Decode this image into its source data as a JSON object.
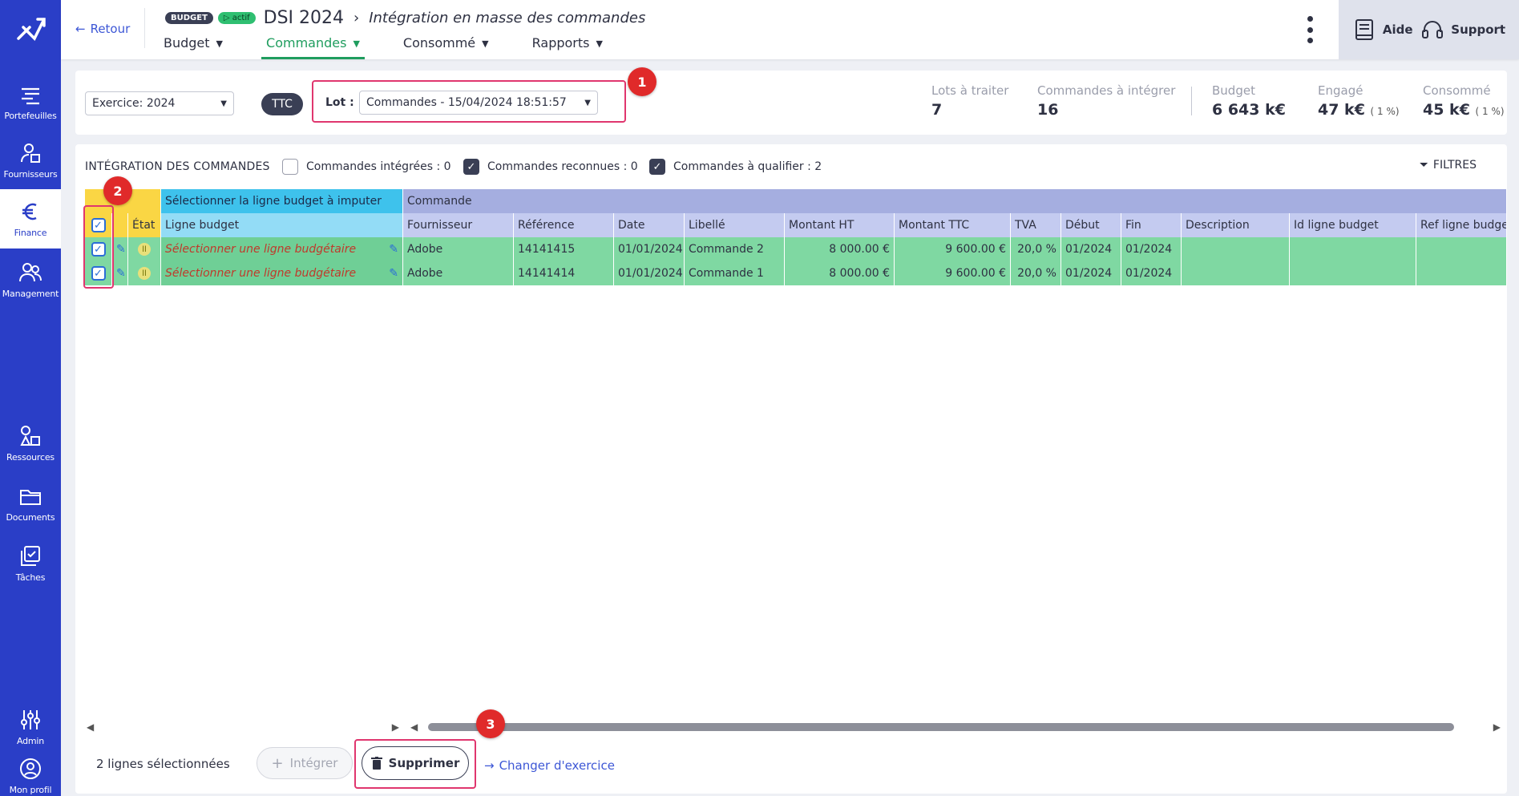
{
  "sidebar": {
    "items": [
      {
        "label": "Portefeuilles",
        "icon": "portfolio-icon"
      },
      {
        "label": "Fournisseurs",
        "icon": "supplier-icon"
      },
      {
        "label": "Finance",
        "icon": "euro-icon"
      },
      {
        "label": "Management",
        "icon": "users-icon"
      },
      {
        "label": "Ressources",
        "icon": "shapes-icon"
      },
      {
        "label": "Documents",
        "icon": "folder-icon"
      },
      {
        "label": "Tâches",
        "icon": "tasks-icon"
      },
      {
        "label": "Admin",
        "icon": "sliders-icon"
      },
      {
        "label": "Mon profil",
        "icon": "profile-icon"
      }
    ]
  },
  "header": {
    "back_label": "Retour",
    "badge_budget": "BUDGET",
    "badge_actif": "actif",
    "title": "DSI 2024",
    "subtitle": "Intégration en masse des commandes",
    "tabs": [
      {
        "label": "Budget"
      },
      {
        "label": "Commandes"
      },
      {
        "label": "Consommé"
      },
      {
        "label": "Rapports"
      }
    ],
    "aide_label": "Aide",
    "support_label": "Support"
  },
  "filters": {
    "exercice": "Exercice: 2024",
    "ttc": "TTC",
    "lot_label": "Lot :",
    "lot_value": "Commandes - 15/04/2024 18:51:57"
  },
  "kpis": [
    {
      "label": "Lots à traiter",
      "value": "7",
      "pct": ""
    },
    {
      "label": "Commandes à intégrer",
      "value": "16",
      "pct": ""
    },
    {
      "label": "Budget",
      "value": "6 643 k€",
      "pct": ""
    },
    {
      "label": "Engagé",
      "value": "47 k€",
      "pct": "( 1 %)"
    },
    {
      "label": "Consommé",
      "value": "45 k€",
      "pct": "( 1 %)"
    }
  ],
  "panel": {
    "title": "INTÉGRATION DES COMMANDES",
    "chk_integrees": "Commandes intégrées : 0",
    "chk_reconnues": "Commandes reconnues : 0",
    "chk_qualifier": "Commandes à qualifier : 2",
    "filtres_label": "FILTRES"
  },
  "table": {
    "group_select": "Sélectionner la ligne budget à imputer",
    "group_commande": "Commande",
    "col_etat": "État",
    "col_ligne": "Ligne budget",
    "columns": [
      "Fournisseur",
      "Référence",
      "Date",
      "Libellé",
      "Montant HT",
      "Montant TTC",
      "TVA",
      "Début",
      "Fin",
      "Description",
      "Id ligne budget",
      "Ref ligne budget"
    ],
    "rows": [
      {
        "ligne": "Sélectionner une ligne budgétaire",
        "cells": [
          "Adobe",
          "14141415",
          "01/01/2024",
          "Commande 2",
          "8 000.00 €",
          "9 600.00 €",
          "20,0 %",
          "01/2024",
          "01/2024",
          "",
          "",
          ""
        ]
      },
      {
        "ligne": "Sélectionner une ligne budgétaire",
        "cells": [
          "Adobe",
          "14141414",
          "01/01/2024",
          "Commande 1",
          "8 000.00 €",
          "9 600.00 €",
          "20,0 %",
          "01/2024",
          "01/2024",
          "",
          "",
          ""
        ]
      }
    ]
  },
  "footer": {
    "selected_count": "2 lignes sélectionnées",
    "integrer_label": "Intégrer",
    "supprimer_label": "Supprimer",
    "change_label": "Changer d'exercice"
  },
  "markers": [
    "1",
    "2",
    "3"
  ],
  "colors": {
    "sidebar": "#2a3ec7",
    "accent_green": "#1f9d5e",
    "highlight": "#e0366e",
    "marker": "#e02a2a",
    "row_green": "#7fd8a2"
  }
}
